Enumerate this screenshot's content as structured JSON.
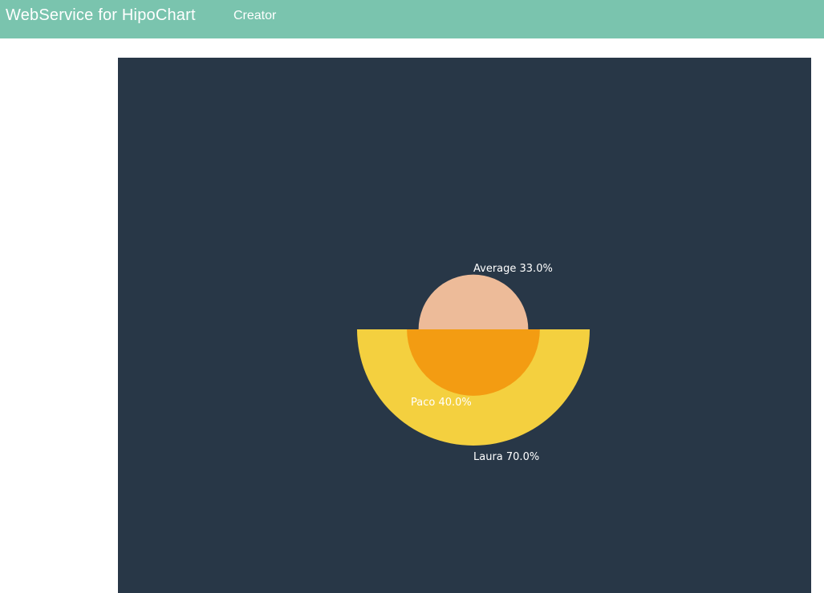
{
  "navbar": {
    "brand": "WebService for HipoChart",
    "links": [
      {
        "label": "Creator"
      }
    ]
  },
  "chart_data": {
    "type": "pie",
    "title": "",
    "series": [
      {
        "name": "Laura",
        "value": 70.0,
        "label": "Laura 70.0%",
        "color": "#f4d03f"
      },
      {
        "name": "Paco",
        "value": 40.0,
        "label": "Paco 40.0%",
        "color": "#f39c12"
      },
      {
        "name": "Average",
        "value": 33.0,
        "label": "Average 33.0%",
        "color": "#edbb99"
      }
    ],
    "background_color": "#283747",
    "navbar_color": "#7ac4ae"
  }
}
